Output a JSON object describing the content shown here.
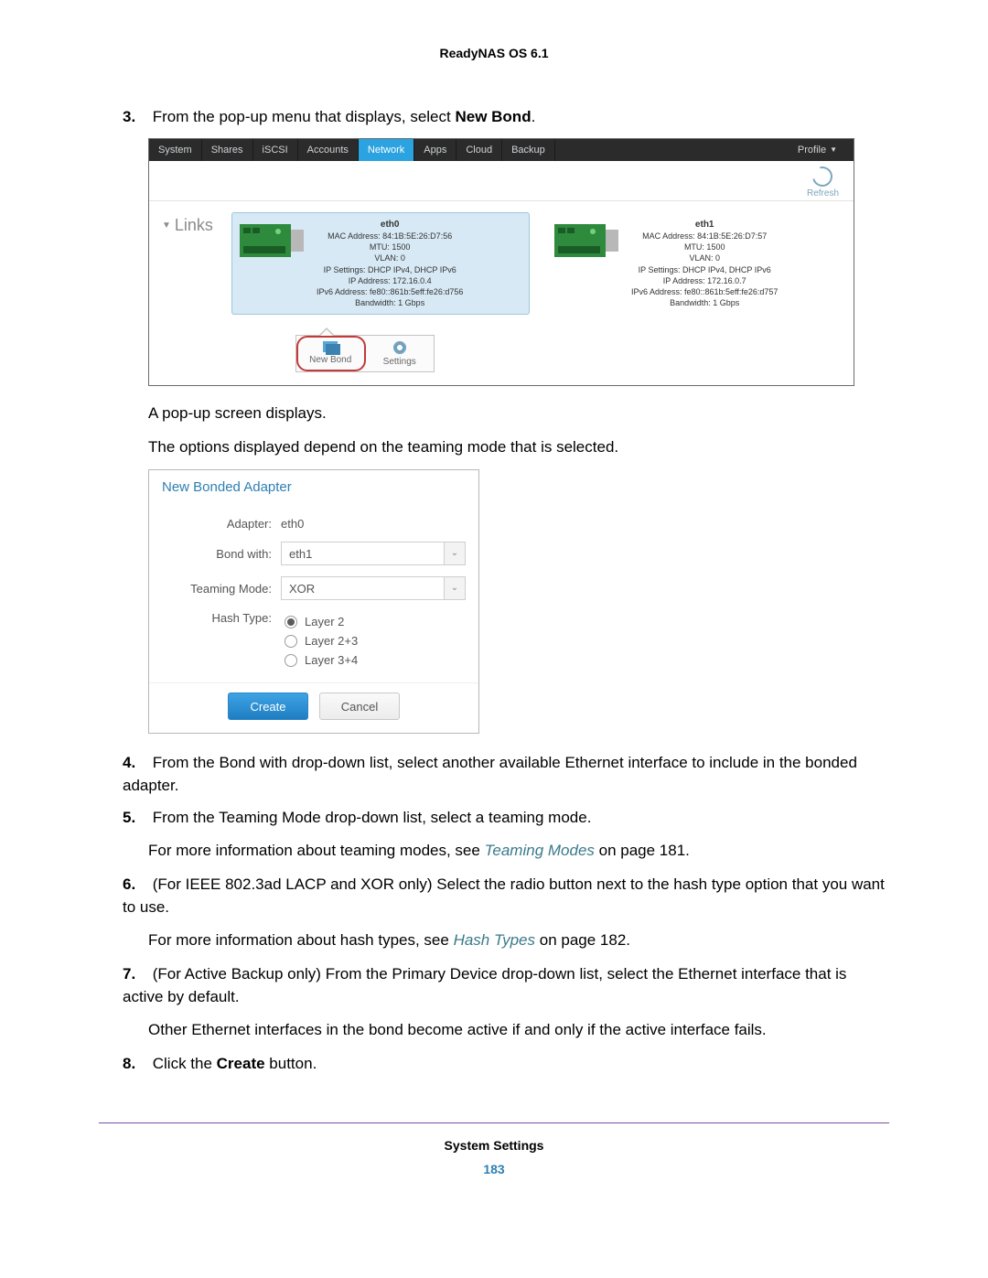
{
  "header_title": "ReadyNAS OS 6.1",
  "steps": {
    "s3_num": "3.",
    "s3_pre": "From the pop-up menu that displays, select ",
    "s3_bold": "New Bond",
    "s3_post": ".",
    "s3_follow1": "A pop-up screen displays.",
    "s3_follow2": "The options displayed depend on the teaming mode that is selected.",
    "s4_num": "4.",
    "s4": "From the Bond with drop-down list, select another available Ethernet interface to include in the bonded adapter.",
    "s5_num": "5.",
    "s5": "From the Teaming Mode drop-down list, select a teaming mode.",
    "s5_follow_pre": "For more information about teaming modes, see ",
    "s5_follow_link": "Teaming Modes",
    "s5_follow_post": " on page 181.",
    "s6_num": "6.",
    "s6": "(For IEEE 802.3ad LACP and XOR only) Select the radio button next to the hash type option that you want to use.",
    "s6_follow_pre": "For more information about hash types, see ",
    "s6_follow_link": "Hash Types",
    "s6_follow_post": " on page 182.",
    "s7_num": "7.",
    "s7": "(For Active Backup only) From the Primary Device drop-down list, select the Ethernet interface that is active by default.",
    "s7_follow": "Other Ethernet interfaces in the bond become active if and only if the active interface fails.",
    "s8_num": "8.",
    "s8_pre": "Click the ",
    "s8_bold": "Create",
    "s8_post": " button."
  },
  "nettabs": {
    "system": "System",
    "shares": "Shares",
    "iscsi": "iSCSI",
    "accounts": "Accounts",
    "network": "Network",
    "apps": "Apps",
    "cloud": "Cloud",
    "backup": "Backup",
    "profile": "Profile"
  },
  "refresh_label": "Refresh",
  "links_title": "Links",
  "eth0": {
    "name": "eth0",
    "mac_label": "MAC Address: 84:1B:5E:26:D7:56",
    "mtu": "MTU: 1500",
    "vlan": "VLAN: 0",
    "ipset": "IP Settings: DHCP IPv4, DHCP IPv6",
    "ip": "IP Address: 172.16.0.4",
    "ipv6": "IPv6 Address: fe80::861b:5eff:fe26:d756",
    "bw": "Bandwidth: 1 Gbps"
  },
  "eth1": {
    "name": "eth1",
    "mac_label": "MAC Address: 84:1B:5E:26:D7:57",
    "mtu": "MTU: 1500",
    "vlan": "VLAN: 0",
    "ipset": "IP Settings: DHCP IPv4, DHCP IPv6",
    "ip": "IP Address: 172.16.0.7",
    "ipv6": "IPv6 Address: fe80::861b:5eff:fe26:d757",
    "bw": "Bandwidth: 1 Gbps"
  },
  "popup": {
    "newbond": "New Bond",
    "settings": "Settings"
  },
  "dialog": {
    "title": "New Bonded Adapter",
    "adapter_label": "Adapter:",
    "adapter_value": "eth0",
    "bondwith_label": "Bond with:",
    "bondwith_value": "eth1",
    "teaming_label": "Teaming Mode:",
    "teaming_value": "XOR",
    "hashtype_label": "Hash Type:",
    "hash_l2": "Layer 2",
    "hash_l23": "Layer 2+3",
    "hash_l34": "Layer 3+4",
    "create": "Create",
    "cancel": "Cancel"
  },
  "footer_title": "System Settings",
  "page_number": "183"
}
